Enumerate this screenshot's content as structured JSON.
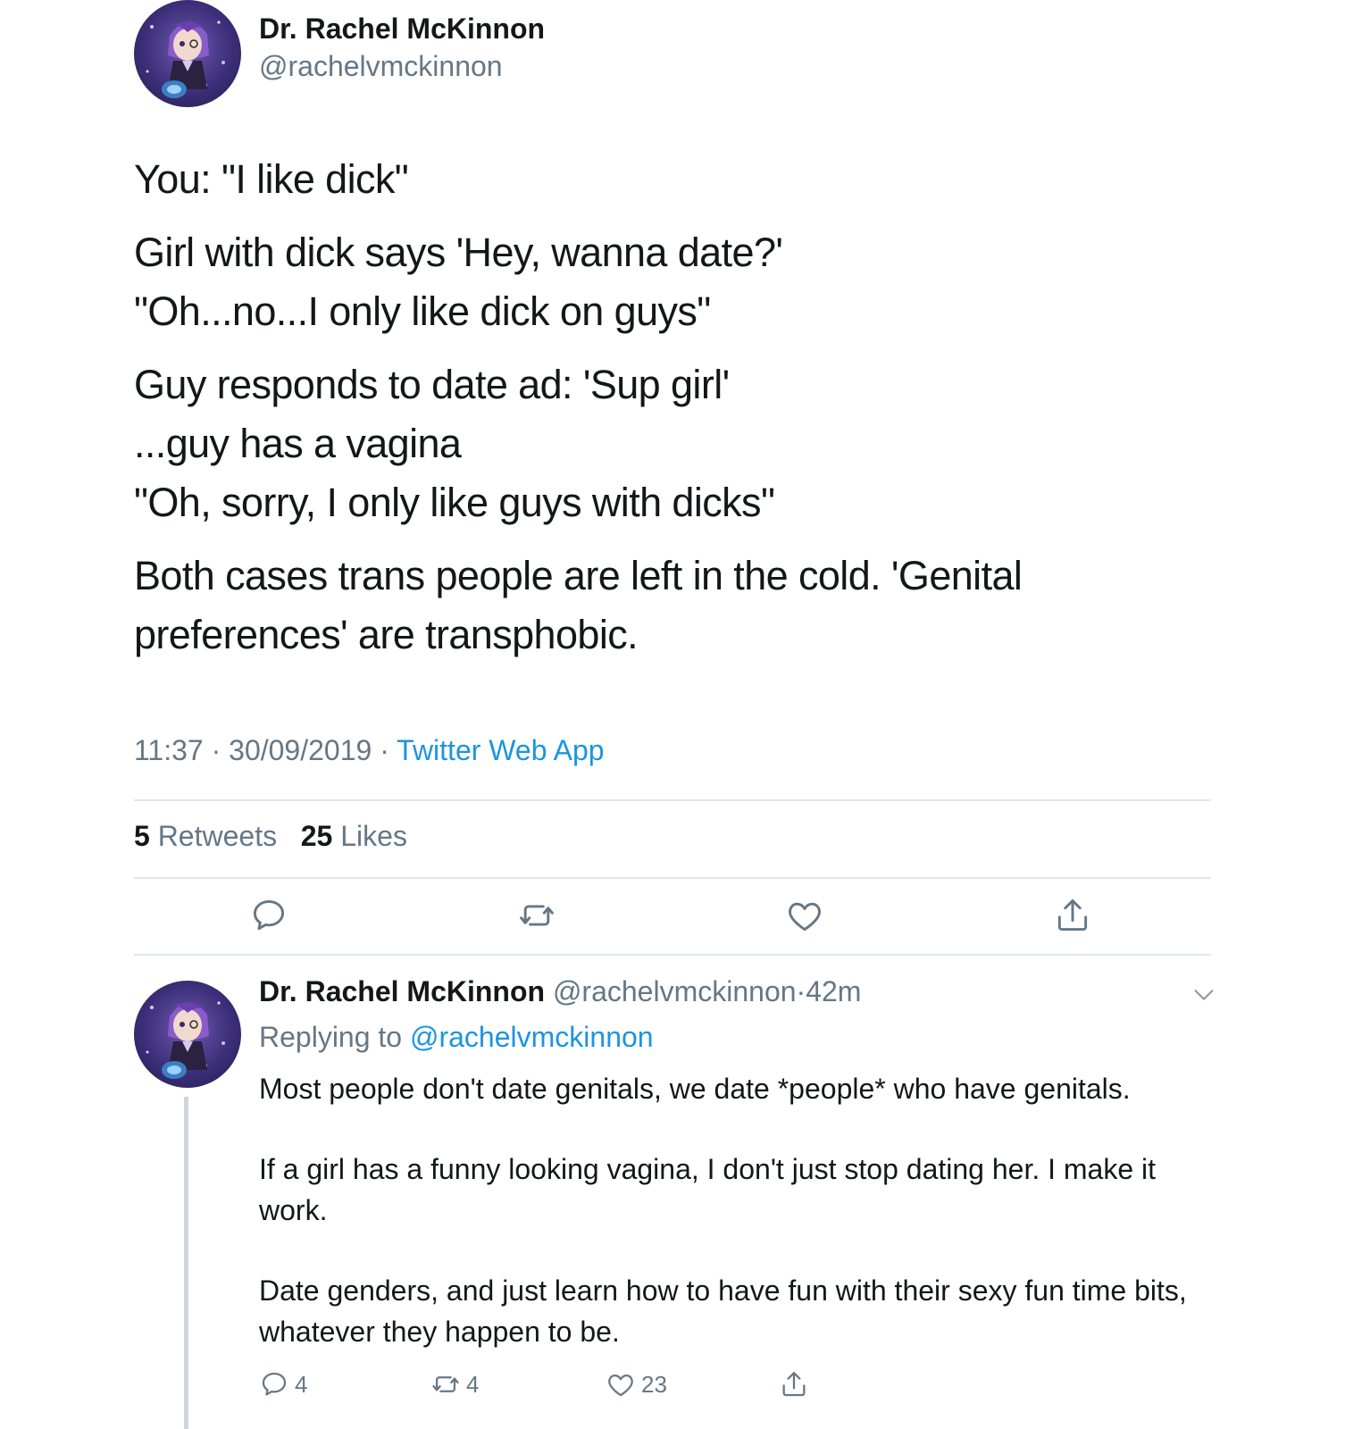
{
  "main_tweet": {
    "author_name": "Dr. Rachel McKinnon",
    "author_handle": "@rachelvmckinnon",
    "avatar_icon": "anime-character-avatar",
    "body": {
      "p1": "You: \"I like dick\"",
      "p2_l1": "Girl with dick says 'Hey, wanna date?'",
      "p2_l2": "\"Oh...no...I only like dick on guys\"",
      "p3_l1": "Guy responds to date ad: 'Sup girl'",
      "p3_l2": "...guy has a vagina",
      "p3_l3": "\"Oh, sorry, I only like guys with dicks\"",
      "p4": "Both cases trans people are left in the cold. 'Genital preferences' are transphobic."
    },
    "time": "11:37",
    "date": "30/09/2019",
    "separator": "·",
    "source": "Twitter Web App",
    "retweet_count": "5",
    "retweet_label": "Retweets",
    "like_count": "25",
    "like_label": "Likes",
    "actions": [
      "reply-icon",
      "retweet-icon",
      "like-icon",
      "share-icon"
    ]
  },
  "reply_tweet": {
    "author_name": "Dr. Rachel McKinnon",
    "author_handle": "@rachelvmckinnon",
    "separator": "·",
    "time_ago": "42m",
    "replying_prefix": "Replying to",
    "replying_handle": "@rachelvmckinnon",
    "body": {
      "p1": "Most people don't date genitals, we date *people* who have genitals.",
      "p2": "If a girl has a funny looking vagina, I don't just stop dating her. I make it work.",
      "p3": "Date genders, and just learn how to have fun with their sexy fun time bits, whatever they happen to be."
    },
    "reply_count": "4",
    "retweet_count": "4",
    "like_count": "23"
  },
  "colors": {
    "text": "#14171a",
    "muted": "#657786",
    "link": "#1b95e0",
    "divider": "#e1e8ed",
    "thread_line": "#ccd6dd"
  }
}
